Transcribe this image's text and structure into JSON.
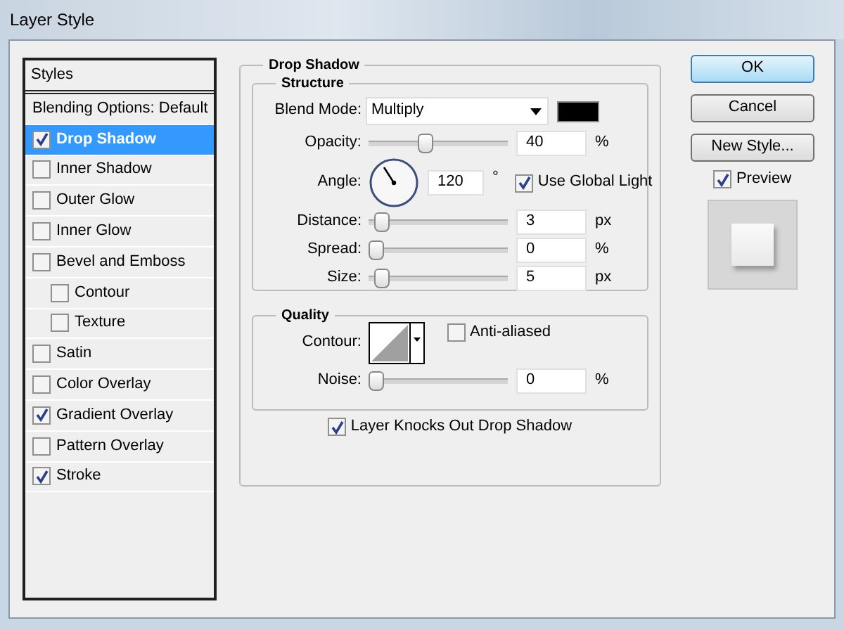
{
  "window": {
    "title": "Layer Style"
  },
  "styles_panel": {
    "header": "Styles",
    "items": [
      {
        "label": "Blending Options: Default",
        "kind": "plain",
        "selected": false
      },
      {
        "label": "Drop Shadow",
        "kind": "check",
        "checked": true,
        "selected": true
      },
      {
        "label": "Inner Shadow",
        "kind": "check",
        "checked": false,
        "selected": false
      },
      {
        "label": "Outer Glow",
        "kind": "check",
        "checked": false,
        "selected": false
      },
      {
        "label": "Inner Glow",
        "kind": "check",
        "checked": false,
        "selected": false
      },
      {
        "label": "Bevel and Emboss",
        "kind": "check",
        "checked": false,
        "selected": false
      },
      {
        "label": "Contour",
        "kind": "sub",
        "checked": false,
        "selected": false
      },
      {
        "label": "Texture",
        "kind": "sub",
        "checked": false,
        "selected": false
      },
      {
        "label": "Satin",
        "kind": "check",
        "checked": false,
        "selected": false
      },
      {
        "label": "Color Overlay",
        "kind": "check",
        "checked": false,
        "selected": false
      },
      {
        "label": "Gradient Overlay",
        "kind": "check",
        "checked": true,
        "selected": false
      },
      {
        "label": "Pattern Overlay",
        "kind": "check",
        "checked": false,
        "selected": false
      },
      {
        "label": "Stroke",
        "kind": "check",
        "checked": true,
        "selected": false
      }
    ]
  },
  "drop_shadow": {
    "title": "Drop Shadow",
    "structure": {
      "title": "Structure",
      "blend_mode": {
        "label": "Blend Mode:",
        "value": "Multiply",
        "color": "#000000"
      },
      "opacity": {
        "label": "Opacity:",
        "level": 0.4,
        "value": "40",
        "unit": "%"
      },
      "angle": {
        "label": "Angle:",
        "value": "120",
        "unit": "°",
        "global_light": {
          "label": "Use Global Light",
          "checked": true
        }
      },
      "sliders": [
        {
          "label": "Distance:",
          "level": 0.04,
          "value": "3",
          "unit": "px"
        },
        {
          "label": "Spread:",
          "level": 0.0,
          "value": "0",
          "unit": "%"
        },
        {
          "label": "Size:",
          "level": 0.05,
          "value": "5",
          "unit": "px"
        }
      ]
    },
    "quality": {
      "title": "Quality",
      "contour_label": "Contour:",
      "anti_aliased": {
        "label": "Anti-aliased",
        "checked": false
      },
      "noise": {
        "label": "Noise:",
        "level": 0.0,
        "value": "0",
        "unit": "%"
      }
    },
    "knockout": {
      "label": "Layer Knocks Out Drop Shadow",
      "checked": true
    }
  },
  "buttons": [
    {
      "label": "OK",
      "default": true
    },
    {
      "label": "Cancel",
      "default": false
    },
    {
      "label": "New Style...",
      "default": false
    }
  ],
  "preview": {
    "label": "Preview",
    "checked": true
  }
}
